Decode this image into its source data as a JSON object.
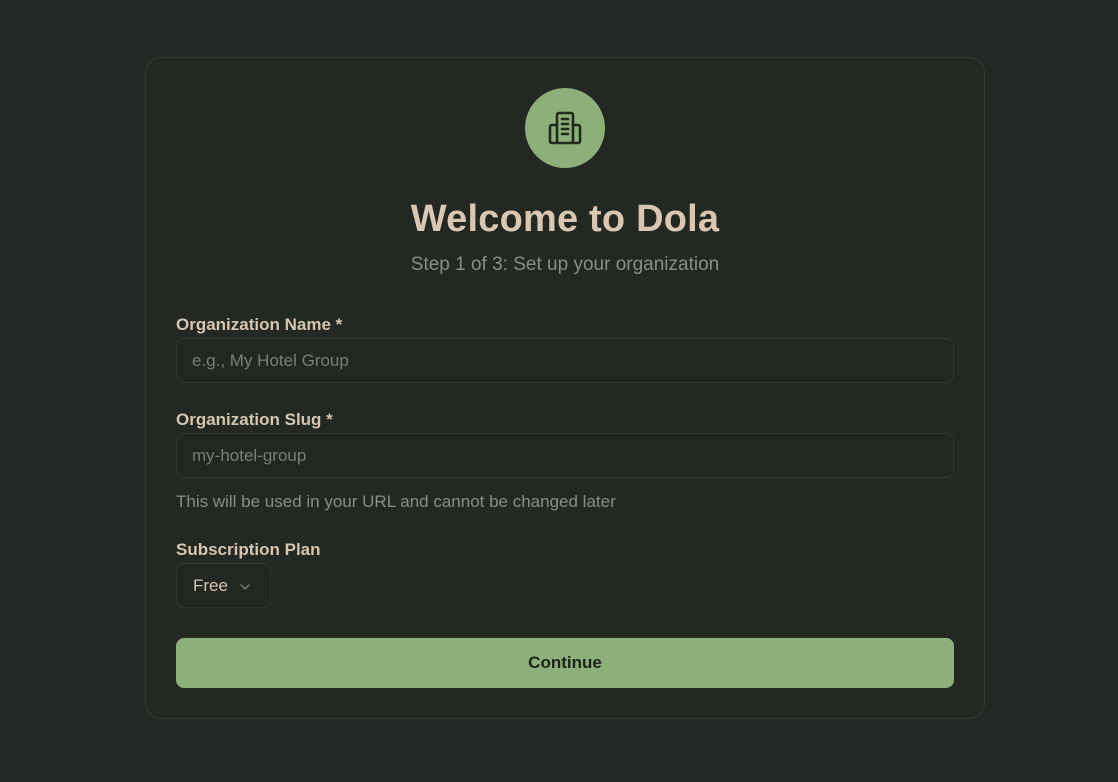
{
  "header": {
    "icon": "building-icon",
    "title": "Welcome to Dola",
    "subtitle": "Step 1 of 3: Set up your organization"
  },
  "form": {
    "org_name": {
      "label": "Organization Name *",
      "value": "",
      "placeholder": "e.g., My Hotel Group"
    },
    "org_slug": {
      "label": "Organization Slug *",
      "value": "",
      "placeholder": "my-hotel-group",
      "help": "This will be used in your URL and cannot be changed later"
    },
    "plan": {
      "label": "Subscription Plan",
      "selected": "Free",
      "icon": "chevron-down-icon"
    },
    "submit_label": "Continue"
  },
  "colors": {
    "background": "#222823",
    "accent": "#8db07a",
    "title_text": "#d9c7b2",
    "muted_text": "#8a8d84"
  }
}
